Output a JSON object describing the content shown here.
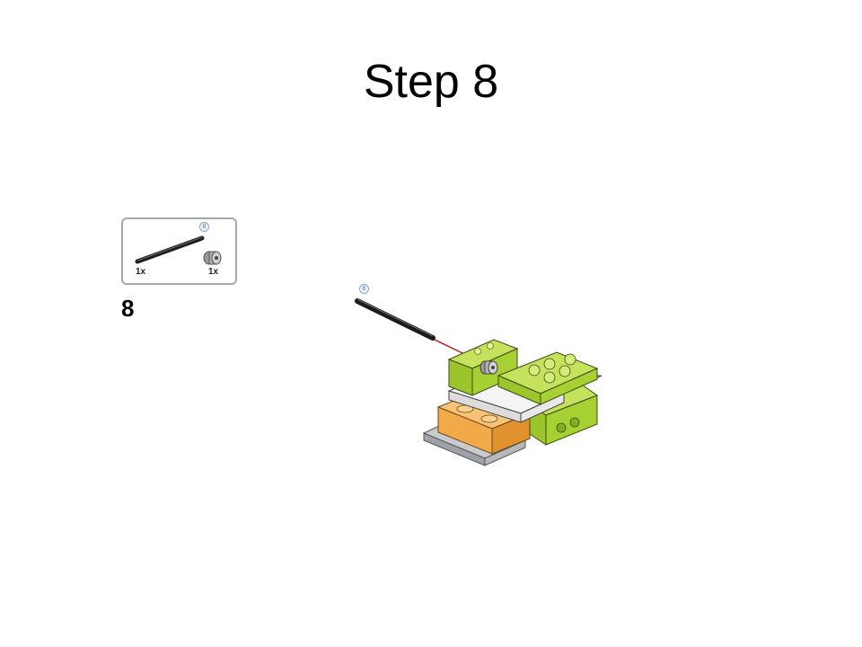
{
  "slide": {
    "title": "Step 8"
  },
  "parts_list": {
    "items": [
      {
        "name": "axle",
        "quantity": "1x",
        "length": "8"
      },
      {
        "name": "bush",
        "quantity": "1x"
      }
    ]
  },
  "instruction": {
    "step_number": "8",
    "axle_length": "8"
  },
  "colors": {
    "lime": "#a7d132",
    "orange": "#f2a94a",
    "gray": "#b8bcc0",
    "white_plate": "#eeeeee",
    "axle": "#2a2a2a",
    "red_arrow": "#cc1a1a"
  }
}
